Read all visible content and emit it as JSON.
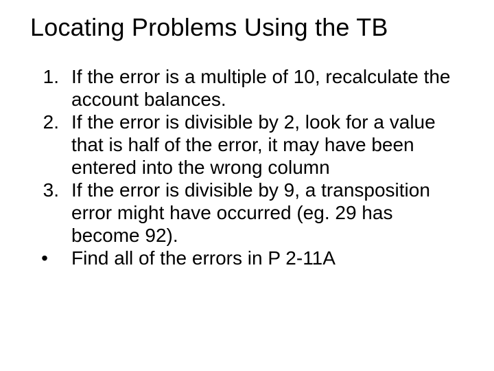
{
  "title": "Locating Problems Using the TB",
  "items": [
    {
      "marker": "1.",
      "text": "If the error is a multiple of 10, recalculate the account balances."
    },
    {
      "marker": "2.",
      "text": "If the error is divisible by 2, look for a value that is half of the error, it may have been entered into the wrong column"
    },
    {
      "marker": "3.",
      "text": "If the error is divisible by 9, a transposition error might have occurred (eg. 29 has become 92)."
    },
    {
      "marker": "•",
      "text": "Find all of the errors in P 2-11A"
    }
  ]
}
